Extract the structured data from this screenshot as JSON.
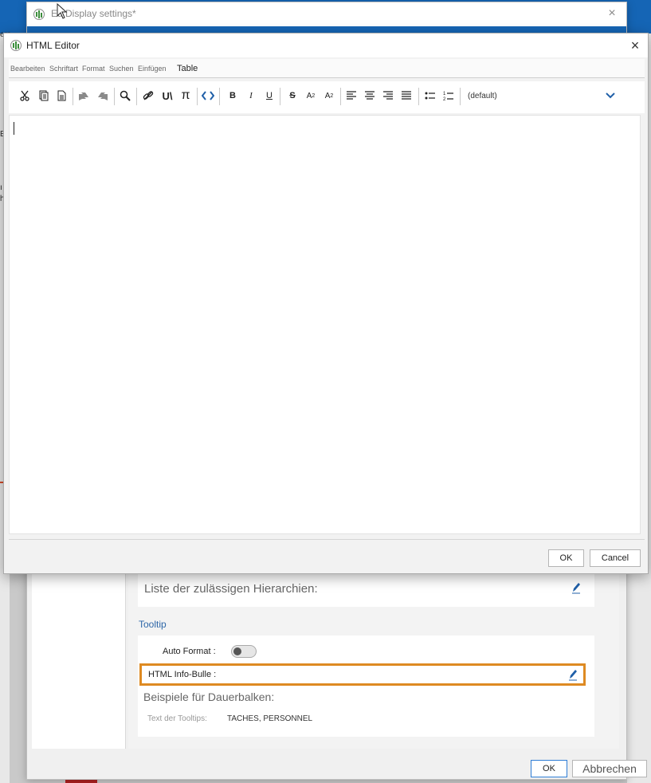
{
  "background": {
    "left_fragments": [
      "ers",
      "Eı",
      "ı",
      "h"
    ]
  },
  "display_dialog": {
    "title": "Ed Display settings*",
    "close_glyph": "×",
    "hierarchies_label": "Liste der zulässigen Hierarchien:",
    "tooltip_section": "Tooltip",
    "auto_format_label": "Auto Format :",
    "auto_format_on": false,
    "html_info_label": "HTML Info-Bulle :",
    "examples_label": "Beispiele für Dauerbalken:",
    "tooltip_text_label": "Text der Tooltips:",
    "tooltip_text_value": "TACHES, PERSONNEL",
    "ok_label": "OK",
    "cancel_label": "Abbrechen"
  },
  "html_editor": {
    "title": "HTML Editor",
    "close_glyph": "×",
    "menu": [
      "Bearbeiten",
      "Schriftart",
      "Format",
      "Suchen",
      "Einfügen",
      "Table"
    ],
    "toolbar_icons": [
      "cut-icon",
      "copy-icon",
      "paste-icon",
      "undo-icon",
      "redo-icon",
      "search-icon",
      "link-icon",
      "unlink-icon",
      "pi-icon",
      "source-code-icon",
      "bold-icon",
      "italic-icon",
      "underline-icon",
      "strikethrough-icon",
      "superscript-icon",
      "subscript-icon",
      "align-left-icon",
      "align-center-icon",
      "align-right-icon",
      "justify-icon",
      "bullet-list-icon",
      "numbered-list-icon",
      "chevron-down-icon"
    ],
    "font_select_value": "(default)",
    "content": "",
    "ok_label": "OK",
    "cancel_label": "Cancel"
  },
  "colors": {
    "accent_blue": "#1565b5",
    "highlight_orange": "#de8a22",
    "section_blue": "#2e67a8"
  }
}
